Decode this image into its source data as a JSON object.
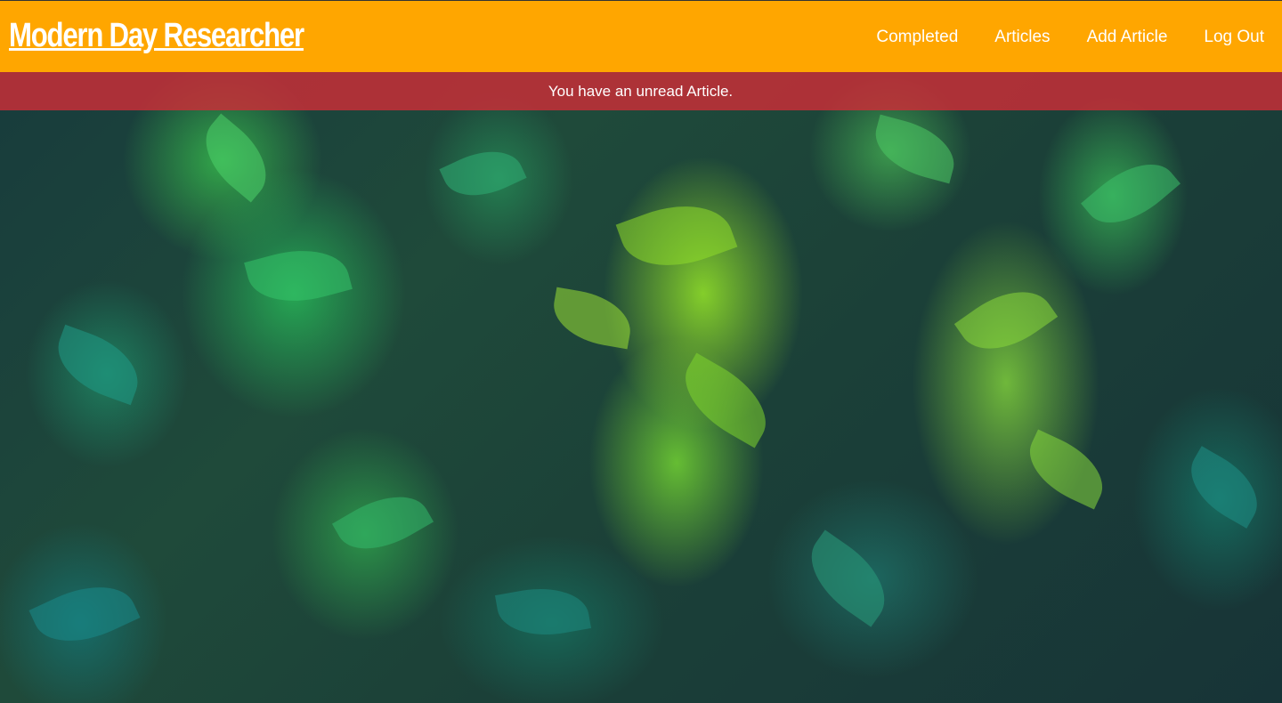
{
  "header": {
    "brand": "Modern Day Researcher",
    "nav": [
      {
        "label": "Completed"
      },
      {
        "label": "Articles"
      },
      {
        "label": "Add Article"
      },
      {
        "label": "Log Out"
      }
    ]
  },
  "alert": {
    "message": "You have an unread Article."
  },
  "background": {
    "subject": "green ivy leaves photo"
  },
  "colors": {
    "navbar": "#ffa600",
    "alert": "#cd2d37",
    "text": "#ffffff"
  }
}
